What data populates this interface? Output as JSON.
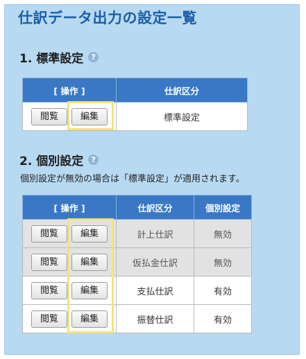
{
  "page": {
    "title": "仕訳データ出力の設定一覧"
  },
  "section1": {
    "heading": "1. 標準設定",
    "help_icon": "question-icon",
    "columns": [
      "[ 操作 ]",
      "仕訳区分"
    ],
    "rows": [
      {
        "view": "閲覧",
        "edit": "編集",
        "category": "標準設定"
      }
    ]
  },
  "section2": {
    "heading": "2. 個別設定",
    "help_icon": "question-icon",
    "note": "個別設定が無効の場合は「標準設定」が適用されます。",
    "columns": [
      "[ 操作 ]",
      "仕訳区分",
      "個別設定"
    ],
    "rows": [
      {
        "view": "閲覧",
        "edit": "編集",
        "category": "計上仕訳",
        "status": "無効"
      },
      {
        "view": "閲覧",
        "edit": "編集",
        "category": "仮払金仕訳",
        "status": "無効"
      },
      {
        "view": "閲覧",
        "edit": "編集",
        "category": "支払仕訳",
        "status": "有効"
      },
      {
        "view": "閲覧",
        "edit": "編集",
        "category": "振替仕訳",
        "status": "有効"
      }
    ]
  },
  "colors": {
    "panel_bg": "#b8d9f2",
    "title": "#1a5fa8",
    "header_bg": "#3a78c5",
    "highlight": "#f3e37a",
    "disabled_row": "#e2e2e2"
  }
}
